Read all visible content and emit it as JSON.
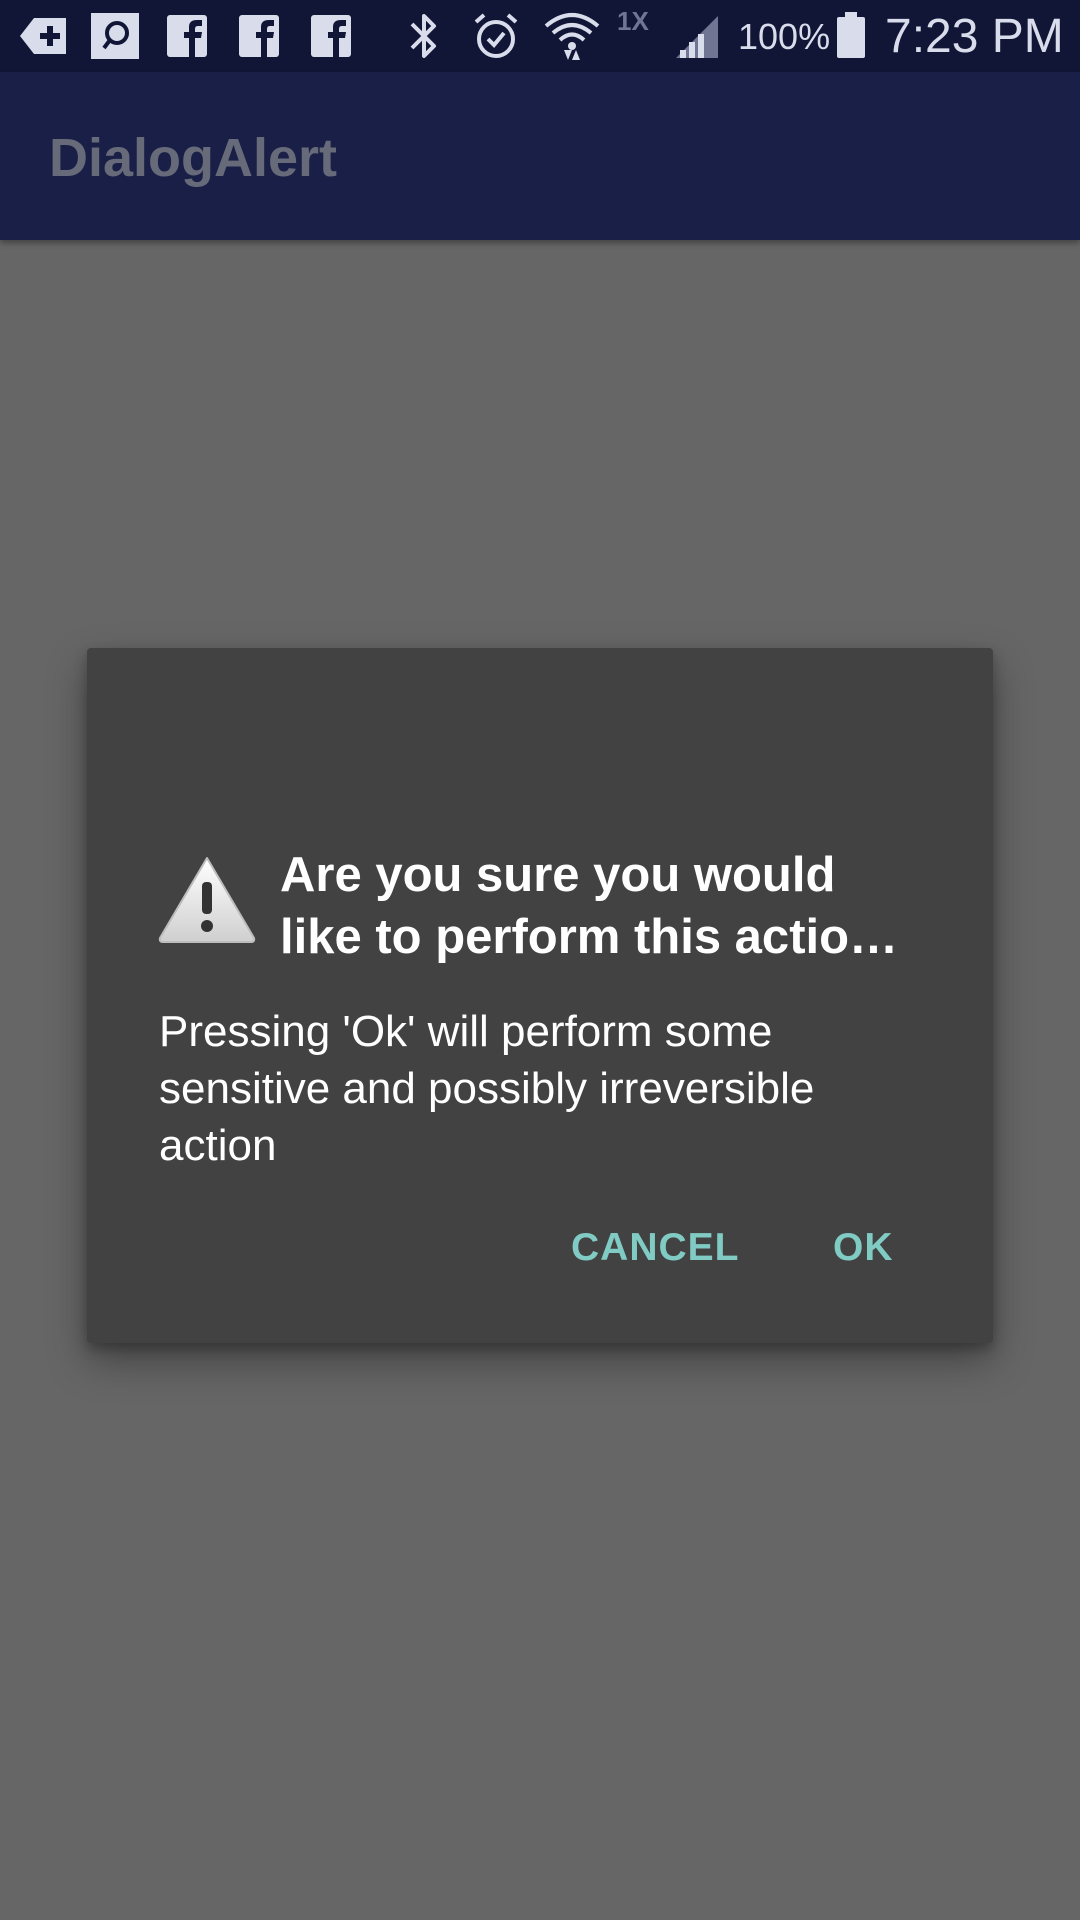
{
  "status_bar": {
    "icons": [
      "add-notification-icon",
      "search-notification-icon",
      "facebook-icon",
      "facebook-icon",
      "facebook-icon",
      "bluetooth-icon",
      "alarm-icon",
      "wifi-icon",
      "cell-signal-icon",
      "battery-icon"
    ],
    "network_label": "1X",
    "battery_percent": "100%",
    "time": "7:23 PM"
  },
  "app_bar": {
    "title": "DialogAlert"
  },
  "dialog": {
    "icon": "warning-icon",
    "title": "Are you sure you would like to perform this actio…",
    "message": "Pressing 'Ok' will perform some sensitive and possibly irreversible action",
    "cancel_label": "CANCEL",
    "ok_label": "OK"
  },
  "colors": {
    "status_bar": "#111637",
    "app_bar": "#1a1f47",
    "scrim_background": "#666666",
    "dialog_background": "#424242",
    "button_accent": "#80cbc4"
  }
}
